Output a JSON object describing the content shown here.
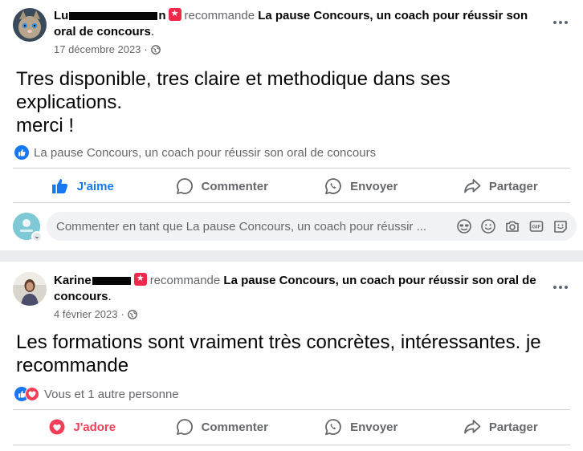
{
  "posts": [
    {
      "author_visible": "Lu",
      "author_visible_end": "n",
      "verb": "recommande",
      "page": "La pause Concours, un coach pour réussir son oral de concours",
      "date": "17 décembre 2023",
      "separator": "·",
      "body_lines": [
        "Tres disponible, tres claire et methodique dans ses",
        "explications.",
        "merci !"
      ],
      "reaction_text": "La pause Concours, un coach pour réussir son oral de concours",
      "actions": {
        "like": "J'aime",
        "comment": "Commenter",
        "send": "Envoyer",
        "share": "Partager"
      },
      "comment_placeholder": "Commenter en tant que La pause Concours, un coach pour réussir ..."
    },
    {
      "author_visible": "Karine",
      "verb": "recommande",
      "page": "La pause Concours, un coach pour réussir son oral de concours",
      "date": "4 février 2023",
      "separator": "·",
      "body_lines": [
        "Les formations sont vraiment très concrètes, intéressantes. je",
        "recommande"
      ],
      "reaction_text": "Vous et 1 autre personne",
      "actions": {
        "love": "J'adore",
        "comment": "Commenter",
        "send": "Envoyer",
        "share": "Partager"
      }
    }
  ],
  "colors": {
    "brand_blue": "#1877f2",
    "love_red": "#f33e58",
    "recommend_badge": "#f02849",
    "muted_text": "#65676b"
  },
  "icons": [
    "globe-icon",
    "more-icon",
    "like-icon",
    "comment-icon",
    "messenger-icon",
    "share-icon",
    "heart-icon",
    "sticker-icon",
    "emoji-icon",
    "camera-icon",
    "gif-icon",
    "avatar-sticker-icon"
  ]
}
